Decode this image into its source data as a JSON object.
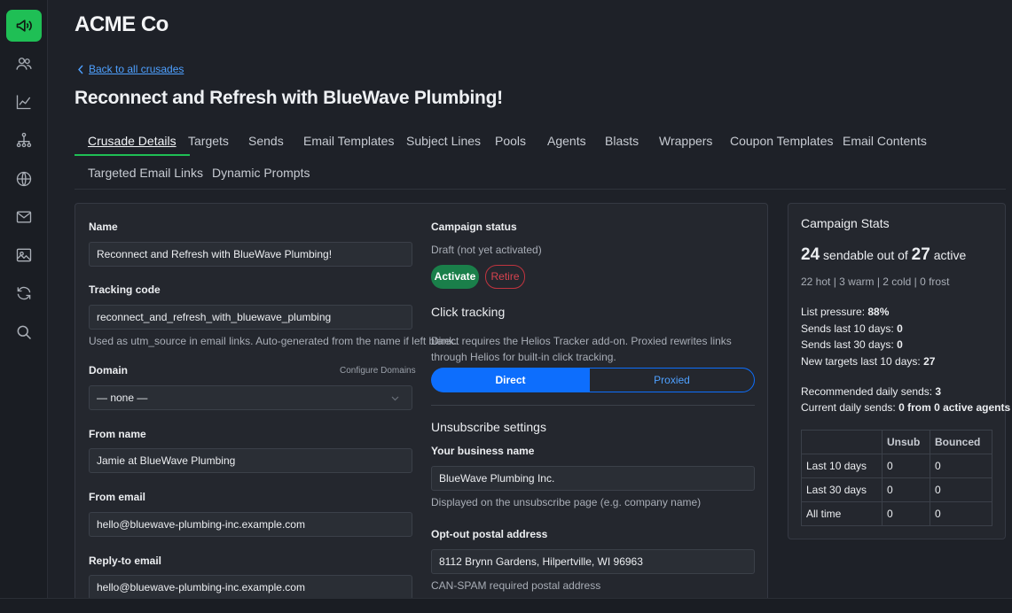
{
  "brand": "ACME Co",
  "back_link": "Back to all crusades",
  "page_title": "Reconnect and Refresh with BlueWave Plumbing!",
  "colors": {
    "accent": "#1fbf55",
    "primary": "#0d6efd",
    "danger": "#d6434f",
    "activate": "#1a7f4a"
  },
  "sidebar": {
    "icons": [
      "megaphone-icon",
      "users-icon",
      "chart-icon",
      "network-icon",
      "globe-icon",
      "mail-icon",
      "image-icon",
      "refresh-icon",
      "search-icon"
    ]
  },
  "tabs": [
    "Crusade Details",
    "Targets",
    "Sends",
    "Email Templates",
    "Subject Lines",
    "Pools",
    "Agents",
    "Blasts",
    "Wrappers",
    "Coupon Templates",
    "Email Contents",
    "Targeted Email Links",
    "Dynamic Prompts"
  ],
  "form": {
    "name_label": "Name",
    "name_value": "Reconnect and Refresh with BlueWave Plumbing!",
    "tracking_label": "Tracking code",
    "tracking_value": "reconnect_and_refresh_with_bluewave_plumbing",
    "tracking_hint": "Used as utm_source in email links. Auto-generated from the name if left blank.",
    "domain_label": "Domain",
    "domain_configure": "Configure Domains",
    "domain_value": "— none —",
    "from_name_label": "From name",
    "from_name_value": "Jamie at BlueWave Plumbing",
    "from_email_label": "From email",
    "from_email_value": "hello@bluewave-plumbing-inc.example.com",
    "reply_to_label": "Reply-to email",
    "reply_to_value": "hello@bluewave-plumbing-inc.example.com"
  },
  "status": {
    "heading": "Campaign status",
    "state": "Draft (not yet activated)",
    "activate": "Activate",
    "retire": "Retire"
  },
  "click_tracking": {
    "heading": "Click tracking",
    "description": "Direct requires the Helios Tracker add-on. Proxied rewrites links through Helios for built-in click tracking.",
    "direct": "Direct",
    "proxied": "Proxied"
  },
  "unsubscribe": {
    "heading": "Unsubscribe settings",
    "business_label": "Your business name",
    "business_value": "BlueWave Plumbing Inc.",
    "business_hint": "Displayed on the unsubscribe page (e.g. company name)",
    "postal_label": "Opt-out postal address",
    "postal_value": "8112 Brynn Gardens, Hilpertville, WI 96963",
    "postal_hint": "CAN-SPAM required postal address"
  },
  "stats": {
    "title": "Campaign Stats",
    "sendable": "24",
    "sendable_text": "sendable out of",
    "active": "27",
    "active_text": "active",
    "temps": "22 hot | 3 warm | 2 cold | 0 frost",
    "list_pressure_label": "List pressure:",
    "list_pressure": "88%",
    "sends10_label": "Sends last 10 days:",
    "sends10": "0",
    "sends30_label": "Sends last 30 days:",
    "sends30": "0",
    "newtargets_label": "New targets last 10 days:",
    "newtargets": "27",
    "recommended_label": "Recommended daily sends:",
    "recommended": "3",
    "current_label": "Current daily sends:",
    "current": "0 from 0 active agents",
    "table": {
      "headers": [
        "",
        "Unsub",
        "Bounced"
      ],
      "rows": [
        [
          "Last 10 days",
          "0",
          "0"
        ],
        [
          "Last 30 days",
          "0",
          "0"
        ],
        [
          "All time",
          "0",
          "0"
        ]
      ]
    }
  }
}
